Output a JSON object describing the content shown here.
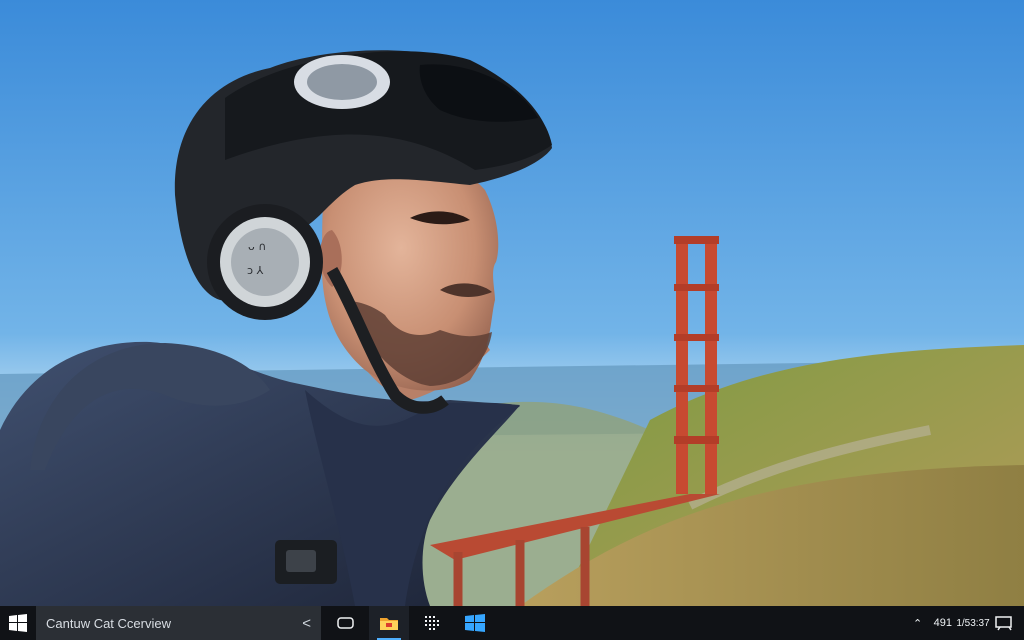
{
  "wallpaper": {
    "scene": "man-with-headset-by-bridge",
    "colors": {
      "sky": "#5aa3e3",
      "bridge": "#c74a31",
      "hill": "#89a64a",
      "jacket": "#2d3650",
      "headset": "#25282c"
    }
  },
  "taskbar": {
    "search_text": "Cantuw Cat Ccerview",
    "search_chevron": "<",
    "tray_number": "491",
    "clock": {
      "line1": "1/5",
      "line2": "3:37"
    }
  },
  "icons": {
    "start": "windows-logo-icon",
    "task_view": "task-view-icon",
    "file_explorer": "file-explorer-icon",
    "app_grid": "app-grid-icon",
    "windows_app": "windows-logo-icon",
    "tray_up": "chevron-up-icon",
    "notification": "notification-icon"
  }
}
